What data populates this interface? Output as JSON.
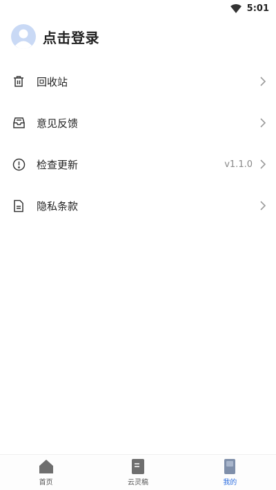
{
  "status_bar": {
    "time": "5:01"
  },
  "header": {
    "login_label": "点击登录"
  },
  "menu": [
    {
      "id": "recycle",
      "label": "回收站",
      "icon": "trash-icon",
      "value": ""
    },
    {
      "id": "feedback",
      "label": "意见反馈",
      "icon": "inbox-icon",
      "value": ""
    },
    {
      "id": "update",
      "label": "检查更新",
      "icon": "info-circle-icon",
      "value": "v1.1.0"
    },
    {
      "id": "privacy",
      "label": "隐私条款",
      "icon": "document-icon",
      "value": ""
    }
  ],
  "bottom_nav": [
    {
      "label": "首页",
      "icon": "home-icon",
      "active": false
    },
    {
      "label": "云灵稿",
      "icon": "notebook-icon",
      "active": false
    },
    {
      "label": "我的",
      "icon": "profile-icon",
      "active": true
    }
  ],
  "colors": {
    "accent": "#2f6fe0",
    "text": "#222222",
    "muted": "#888888",
    "avatar": "#c9d9f5"
  }
}
